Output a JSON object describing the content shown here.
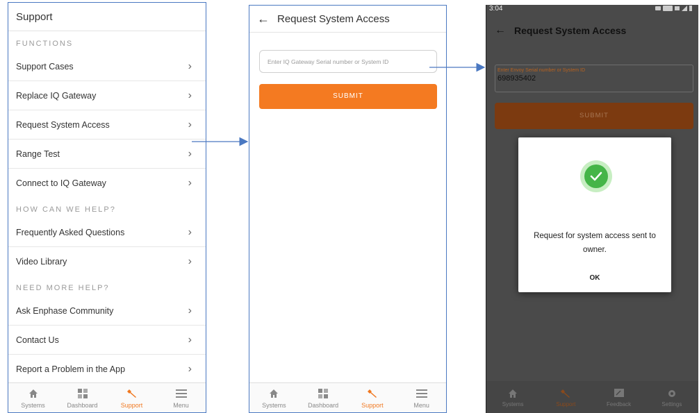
{
  "screen1": {
    "title": "Support",
    "section_functions": "FUNCTIONS",
    "functions": [
      "Support Cases",
      "Replace IQ Gateway",
      "Request System Access",
      "Range Test",
      "Connect to IQ Gateway"
    ],
    "section_help": "HOW CAN WE HELP?",
    "help": [
      "Frequently Asked Questions",
      "Video Library"
    ],
    "section_more": "NEED MORE HELP?",
    "more": [
      "Ask Enphase Community",
      "Contact Us",
      "Report a Problem in the App"
    ],
    "tabs": [
      "Systems",
      "Dashboard",
      "Support",
      "Menu"
    ]
  },
  "screen2": {
    "back": "←",
    "title": "Request System Access",
    "placeholder": "Enter IQ Gateway Serial number or System ID",
    "submit": "SUBMIT",
    "tabs": [
      "Systems",
      "Dashboard",
      "Support",
      "Menu"
    ]
  },
  "screen3": {
    "time": "3:04",
    "back": "←",
    "title": "Request System Access",
    "field_label": "Enter Envoy Serial number or System ID",
    "field_value": "698935402",
    "submit": "SUBMIT",
    "dialog_message": "Request for system access sent to owner.",
    "dialog_ok": "OK",
    "tabs": [
      "Systems",
      "Support",
      "Feedback",
      "Settings"
    ]
  },
  "colors": {
    "accent": "#f47a21",
    "frame": "#4a78c1",
    "success": "#45b548"
  }
}
